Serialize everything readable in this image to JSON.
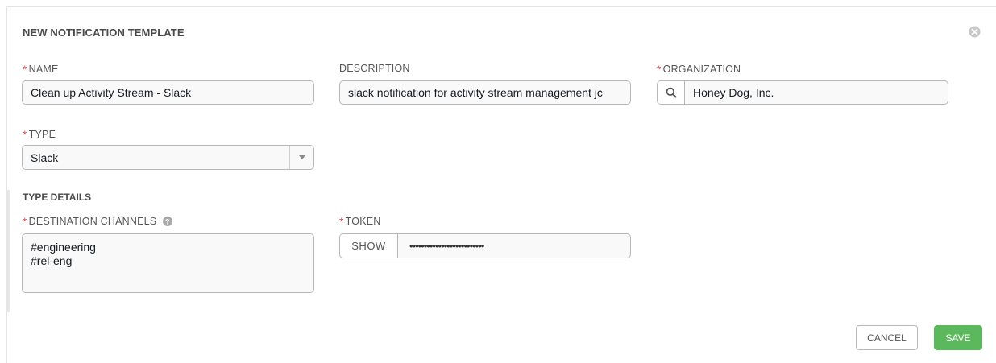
{
  "dialog": {
    "title": "NEW NOTIFICATION TEMPLATE"
  },
  "fields": {
    "name": {
      "required": "*",
      "label": "NAME",
      "value": "Clean up Activity Stream - Slack"
    },
    "description": {
      "label": "DESCRIPTION",
      "value": "slack notification for activity stream management jc"
    },
    "organization": {
      "required": "*",
      "label": "ORGANIZATION",
      "value": "Honey Dog, Inc."
    },
    "type": {
      "required": "*",
      "label": "TYPE",
      "value": "Slack"
    }
  },
  "type_details": {
    "heading": "TYPE DETAILS",
    "destination_channels": {
      "required": "*",
      "label": "DESTINATION CHANNELS",
      "lines": [
        "#engineering",
        "#rel-eng"
      ]
    },
    "token": {
      "required": "*",
      "label": "TOKEN",
      "show_label": "SHOW",
      "masked_value": "••••••••••••••••••••••••••"
    }
  },
  "actions": {
    "cancel_label": "CANCEL",
    "save_label": "SAVE"
  },
  "colors": {
    "required": "#d9534f",
    "save_button": "#5cb85c"
  }
}
